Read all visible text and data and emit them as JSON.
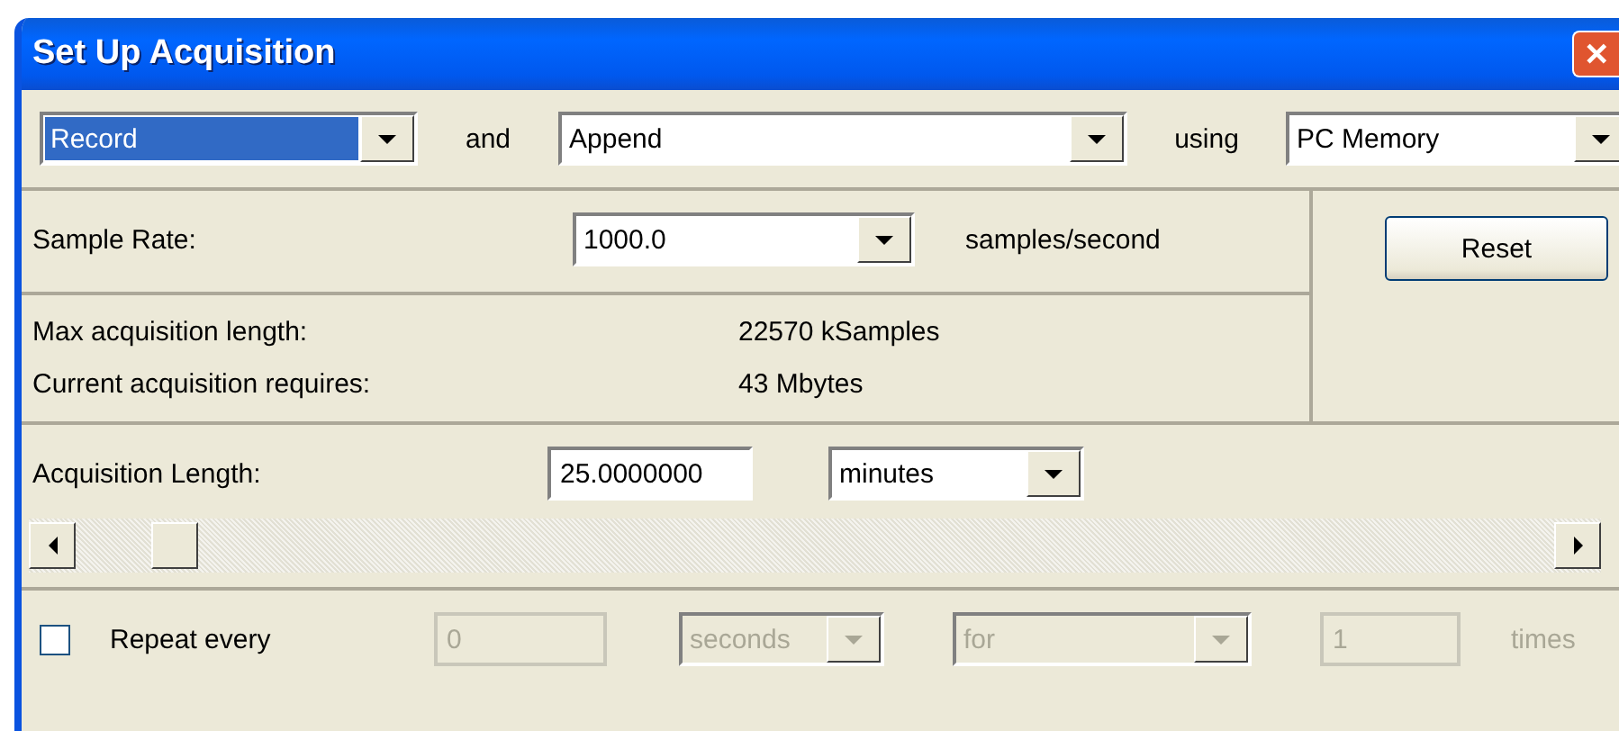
{
  "window": {
    "title": "Set Up Acquisition",
    "close": "✕"
  },
  "mode_row": {
    "mode": {
      "value": "Record",
      "focused": true
    },
    "and_label": "and",
    "action": {
      "value": "Append",
      "focused": false
    },
    "using_label": "using",
    "storage": {
      "value": "PC Memory",
      "focused": false
    }
  },
  "sample_rate": {
    "label": "Sample Rate:",
    "value": "1000.0",
    "unit": "samples/second"
  },
  "info": [
    {
      "label": "Max acquisition length:",
      "value": "22570 kSamples"
    },
    {
      "label": "Current acquisition requires:",
      "value": "43 Mbytes"
    }
  ],
  "reset_button": "Reset",
  "acquisition_length": {
    "label": "Acquisition Length:",
    "value": "25.0000000",
    "unit": "minutes",
    "slider": {
      "level": 0.08
    }
  },
  "repeat": {
    "label": "Repeat every",
    "checked": false,
    "disabled": true,
    "interval": "0",
    "interval_unit": "seconds",
    "duration_mode": "for",
    "count": "1",
    "count_suffix": "times"
  }
}
